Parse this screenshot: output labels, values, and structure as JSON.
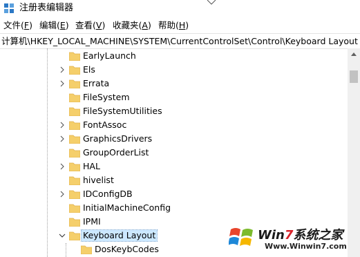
{
  "window": {
    "title": "注册表编辑器"
  },
  "menu": {
    "items": [
      {
        "label_pre": "文件(",
        "key": "F",
        "label_post": ")"
      },
      {
        "label_pre": "编辑(",
        "key": "E",
        "label_post": ")"
      },
      {
        "label_pre": "查看(",
        "key": "V",
        "label_post": ")"
      },
      {
        "label_pre": "收藏夹(",
        "key": "A",
        "label_post": ")"
      },
      {
        "label_pre": "帮助(",
        "key": "H",
        "label_post": ")"
      }
    ]
  },
  "address": {
    "path": "计算机\\HKEY_LOCAL_MACHINE\\SYSTEM\\CurrentControlSet\\Control\\Keyboard Layout"
  },
  "tree": {
    "items": [
      {
        "label": "EarlyLaunch",
        "expandable": false
      },
      {
        "label": "Els",
        "expandable": true
      },
      {
        "label": "Errata",
        "expandable": true
      },
      {
        "label": "FileSystem",
        "expandable": false
      },
      {
        "label": "FileSystemUtilities",
        "expandable": false
      },
      {
        "label": "FontAssoc",
        "expandable": true
      },
      {
        "label": "GraphicsDrivers",
        "expandable": true
      },
      {
        "label": "GroupOrderList",
        "expandable": false
      },
      {
        "label": "HAL",
        "expandable": true
      },
      {
        "label": "hivelist",
        "expandable": false
      },
      {
        "label": "IDConfigDB",
        "expandable": true
      },
      {
        "label": "InitialMachineConfig",
        "expandable": false
      },
      {
        "label": "IPMI",
        "expandable": false
      },
      {
        "label": "Keyboard Layout",
        "expandable": true,
        "expanded": true,
        "selected": true
      },
      {
        "label": "DosKeybCodes",
        "expandable": false,
        "child": true
      }
    ]
  },
  "watermark": {
    "brand_pre": "Win",
    "brand_accent": "7",
    "brand_post": "系统之家",
    "url": "Www.Winwin7.com"
  },
  "colors": {
    "folder": "#f5cf6b",
    "folder_dark": "#e0b04a",
    "selection": "#cce8ff",
    "scrollbar_track": "#f0f0f0",
    "scrollbar_thumb": "#c2c2c2"
  },
  "icons": {
    "app": "registry-editor-icon",
    "folder": "folder-icon",
    "expand": "chevron-right-icon",
    "collapse": "chevron-down-icon"
  }
}
